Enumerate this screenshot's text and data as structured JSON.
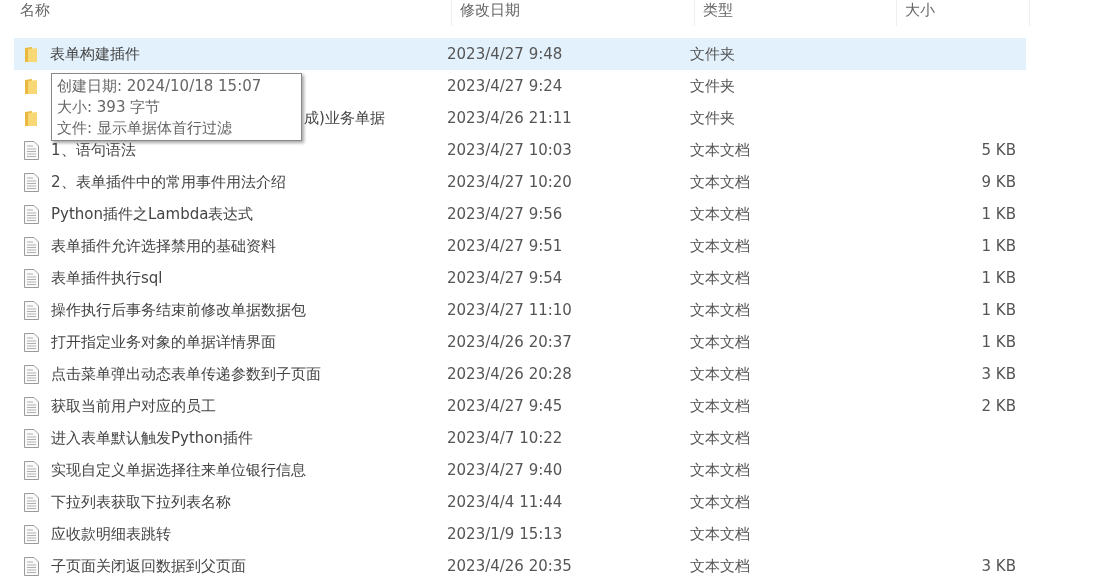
{
  "columns": [
    {
      "label": "名称"
    },
    {
      "label": "修改日期"
    },
    {
      "label": "类型"
    },
    {
      "label": "大小"
    }
  ],
  "rows": [
    {
      "kind": "folder",
      "name": "表单构建插件",
      "date": "2023/4/27 9:48",
      "type": "文件夹",
      "selected": true
    },
    {
      "kind": "folder",
      "date": "2023/4/27 9:24",
      "type": "文件夹",
      "selected": false
    },
    {
      "kind": "folder",
      "name_tail": "成)业务单据",
      "date": "2023/4/26 21:11",
      "type": "文件夹",
      "selected": false
    },
    {
      "kind": "file",
      "name": "1、语句语法",
      "date": "2023/4/27 10:03",
      "type": "文本文档",
      "size": "5 KB",
      "selected": false
    },
    {
      "kind": "file",
      "name": "2、表单插件中的常用事件用法介绍",
      "date": "2023/4/27 10:20",
      "type": "文本文档",
      "size": "9 KB",
      "selected": false
    },
    {
      "kind": "file",
      "name": "Python插件之Lambda表达式",
      "date": "2023/4/27 9:56",
      "type": "文本文档",
      "size": "1 KB",
      "selected": false
    },
    {
      "kind": "file",
      "name": "表单插件允许选择禁用的基础资料",
      "date": "2023/4/27 9:51",
      "type": "文本文档",
      "size": "1 KB",
      "selected": false
    },
    {
      "kind": "file",
      "name": "表单插件执行sql",
      "date": "2023/4/27 9:54",
      "type": "文本文档",
      "size": "1 KB",
      "selected": false
    },
    {
      "kind": "file",
      "name": "操作执行后事务结束前修改单据数据包",
      "date": "2023/4/27 11:10",
      "type": "文本文档",
      "size": "1 KB",
      "selected": false
    },
    {
      "kind": "file",
      "name": "打开指定业务对象的单据详情界面",
      "date": "2023/4/26 20:37",
      "type": "文本文档",
      "size": "1 KB",
      "selected": false
    },
    {
      "kind": "file",
      "name": "点击菜单弹出动态表单传递参数到子页面",
      "date": "2023/4/26 20:28",
      "type": "文本文档",
      "size": "3 KB",
      "selected": false
    },
    {
      "kind": "file",
      "name": "获取当前用户对应的员工",
      "date": "2023/4/27 9:45",
      "type": "文本文档",
      "size": "2 KB",
      "selected": false
    },
    {
      "kind": "file",
      "name": "进入表单默认触发Python插件",
      "date": "2023/4/7 10:22",
      "type": "文本文档",
      "selected": false
    },
    {
      "kind": "file",
      "name": "实现自定义单据选择往来单位银行信息",
      "date": "2023/4/27 9:40",
      "type": "文本文档",
      "selected": false
    },
    {
      "kind": "file",
      "name": "下拉列表获取下拉列表名称",
      "date": "2023/4/4 11:44",
      "type": "文本文档",
      "selected": false
    },
    {
      "kind": "file",
      "name": "应收款明细表跳转",
      "date": "2023/1/9 15:13",
      "type": "文本文档",
      "selected": false
    },
    {
      "kind": "file",
      "name": "子页面关闭返回数据到父页面",
      "date": "2023/4/26 20:35",
      "type": "文本文档",
      "size": "3 KB",
      "selected": false
    }
  ],
  "tooltip": {
    "lines": [
      "创建日期: 2024/10/18 15:07",
      "大小: 393 字节",
      "文件: 显示单据体首行过滤"
    ]
  }
}
